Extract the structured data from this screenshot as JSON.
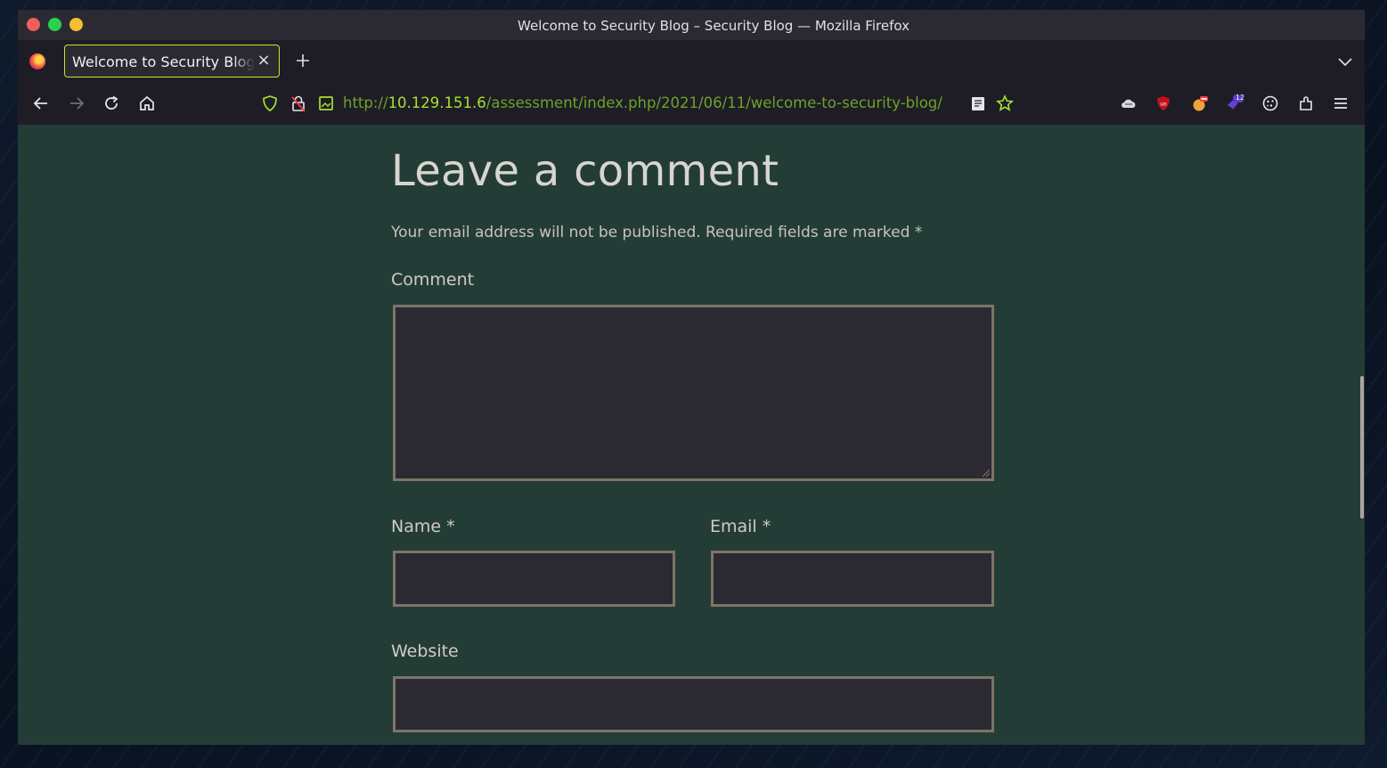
{
  "window": {
    "title": "Welcome to Security Blog – Security Blog — Mozilla Firefox"
  },
  "tabs": [
    {
      "label": "Welcome to Security Blog – Security Blog",
      "active": true
    }
  ],
  "navbar": {
    "url_prefix": "http://",
    "url_host": "10.129.151.6",
    "url_path": "/assessment/index.php/2021/06/11/welcome-to-security-blog/",
    "extension_badge": "12"
  },
  "comment_form": {
    "heading": "Leave a comment",
    "notes": "Your email address will not be published. Required fields are marked *",
    "comment_label": "Comment",
    "comment_value": "",
    "name_label": "Name *",
    "name_value": "",
    "email_label": "Email *",
    "email_value": "",
    "website_label": "Website",
    "website_value": ""
  },
  "colors": {
    "page_background": "#233d36",
    "field_background": "#2b2a33",
    "field_border": "#7e7466",
    "url_accent": "#6ea22b",
    "tab_border": "#b8e92a"
  },
  "icons": [
    "firefox-icon",
    "close-icon",
    "plus-icon",
    "chevron-down-icon",
    "back-icon",
    "forward-icon",
    "reload-icon",
    "home-icon",
    "shield-icon",
    "lock-warning-icon",
    "image-icon",
    "reader-view-icon",
    "star-icon",
    "cloud-extension-icon",
    "ublock-icon",
    "extension-icon",
    "extension-badge-icon",
    "cookie-icon",
    "extensions-puzzle-icon",
    "menu-icon"
  ]
}
